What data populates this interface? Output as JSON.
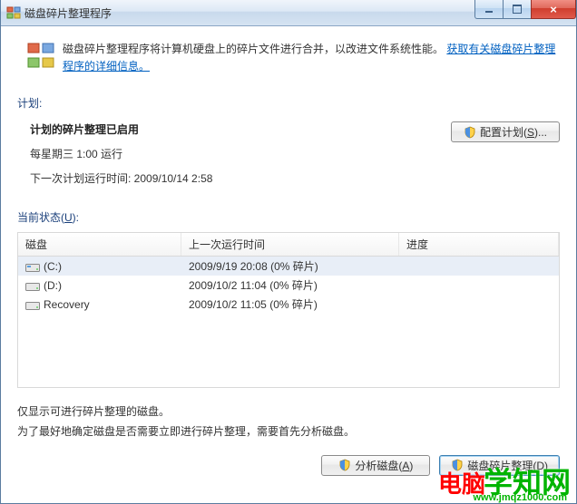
{
  "window": {
    "title": "磁盘碎片整理程序"
  },
  "info": {
    "text": "磁盘碎片整理程序将计算机硬盘上的碎片文件进行合并，以改进文件系统性能。",
    "link": "获取有关磁盘碎片整理程序的详细信息。"
  },
  "sections": {
    "schedule_label": "计划:",
    "status_label_prefix": "当前状态(",
    "status_label_mn": "U",
    "status_label_suffix": "):"
  },
  "schedule": {
    "heading": "计划的碎片整理已启用",
    "line1": "每星期三  1:00 运行",
    "line2": "下一次计划运行时间: 2009/10/14 2:58"
  },
  "buttons": {
    "configure_prefix": "配置计划(",
    "configure_mn": "S",
    "configure_suffix": ")...",
    "analyze_prefix": "分析磁盘(",
    "analyze_mn": "A",
    "analyze_suffix": ")",
    "defrag": "磁盘碎片整理(D)"
  },
  "columns": {
    "disk": "磁盘",
    "last": "上一次运行时间",
    "progress": "进度"
  },
  "disks": [
    {
      "name": "(C:)",
      "last": "2009/9/19 20:08 (0% 碎片)",
      "icon": "c"
    },
    {
      "name": "(D:)",
      "last": "2009/10/2 11:04 (0% 碎片)",
      "icon": "hdd"
    },
    {
      "name": "Recovery",
      "last": "2009/10/2 11:05 (0% 碎片)",
      "icon": "hdd"
    }
  ],
  "notes": {
    "line1": "仅显示可进行碎片整理的磁盘。",
    "line2": "为了最好地确定磁盘是否需要立即进行碎片整理，需要首先分析磁盘。"
  },
  "watermark": {
    "a": "电脑",
    "b": "学知网",
    "url": "www.jmqz1000.com"
  }
}
